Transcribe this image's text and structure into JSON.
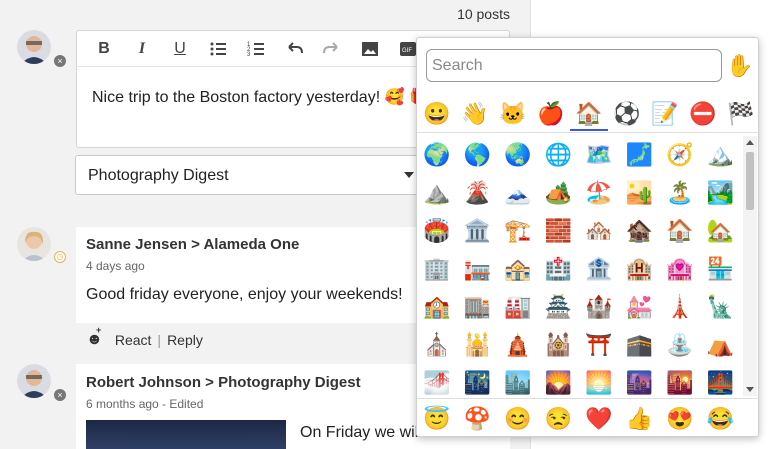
{
  "feed": {
    "posts_count": "10 posts",
    "composer": {
      "text": "Nice trip to the Boston factory yesterday! 🥰 🎁",
      "toolbar": [
        {
          "name": "bold-button",
          "glyph": "B"
        },
        {
          "name": "italic-button",
          "glyph": "I"
        },
        {
          "name": "underline-button",
          "glyph": "U"
        },
        {
          "name": "bullet-list-button",
          "glyph": "bullets"
        },
        {
          "name": "numbered-list-button",
          "glyph": "numbers"
        },
        {
          "name": "undo-button",
          "glyph": "undo"
        },
        {
          "name": "redo-button",
          "glyph": "redo"
        },
        {
          "name": "image-button",
          "glyph": "image"
        },
        {
          "name": "gif-button",
          "glyph": "GIF"
        }
      ]
    },
    "audience_select": {
      "value": "Photography Digest"
    },
    "posts": [
      {
        "author": "Sanne Jensen",
        "separator": ">",
        "group": "Alameda One",
        "meta": "4 days ago",
        "body": "Good friday everyone, enjoy your weekends!",
        "react_label": "React",
        "reply_label": "Reply",
        "action_separator": "|"
      },
      {
        "author": "Robert Johnson",
        "separator": ">",
        "group": "Photography Digest",
        "meta": "6 months ago - Edited",
        "body": "On Friday we will have a"
      }
    ]
  },
  "emoji_picker": {
    "search_placeholder": "Search",
    "skin_tone_icon": "✋",
    "categories": [
      {
        "name": "smileys",
        "icon": "😀"
      },
      {
        "name": "people",
        "icon": "👋"
      },
      {
        "name": "animals",
        "icon": "🐱"
      },
      {
        "name": "food",
        "icon": "🍎"
      },
      {
        "name": "places",
        "icon": "🏠",
        "selected": true
      },
      {
        "name": "activities",
        "icon": "⚽"
      },
      {
        "name": "objects",
        "icon": "📝"
      },
      {
        "name": "symbols",
        "icon": "⛔"
      },
      {
        "name": "flags",
        "icon": "🏁"
      }
    ],
    "grid_rows": [
      [
        "🌍",
        "🌎",
        "🌏",
        "🌐",
        "🗺️",
        "🗾",
        "🧭",
        "🏔️"
      ],
      [
        "⛰️",
        "🌋",
        "🗻",
        "🏕️",
        "🏖️",
        "🏜️",
        "🏝️",
        "🏞️"
      ],
      [
        "🏟️",
        "🏛️",
        "🏗️",
        "🧱",
        "🏘️",
        "🏚️",
        "🏠",
        "🏡"
      ],
      [
        "🏢",
        "🏣",
        "🏤",
        "🏥",
        "🏦",
        "🏨",
        "🏩",
        "🏪"
      ],
      [
        "🏫",
        "🏬",
        "🏭",
        "🏯",
        "🏰",
        "💒",
        "🗼",
        "🗽"
      ],
      [
        "⛪",
        "🕌",
        "🛕",
        "🕍",
        "⛩️",
        "🕋",
        "⛲",
        "⛺"
      ],
      [
        "🌁",
        "🌃",
        "🏙️",
        "🌄",
        "🌅",
        "🌆",
        "🌇",
        "🌉"
      ]
    ],
    "recent": [
      "😇",
      "🍄",
      "😊",
      "😒",
      "❤️",
      "👍",
      "😍",
      "😂"
    ],
    "accent_color": "#3b5bdb"
  }
}
